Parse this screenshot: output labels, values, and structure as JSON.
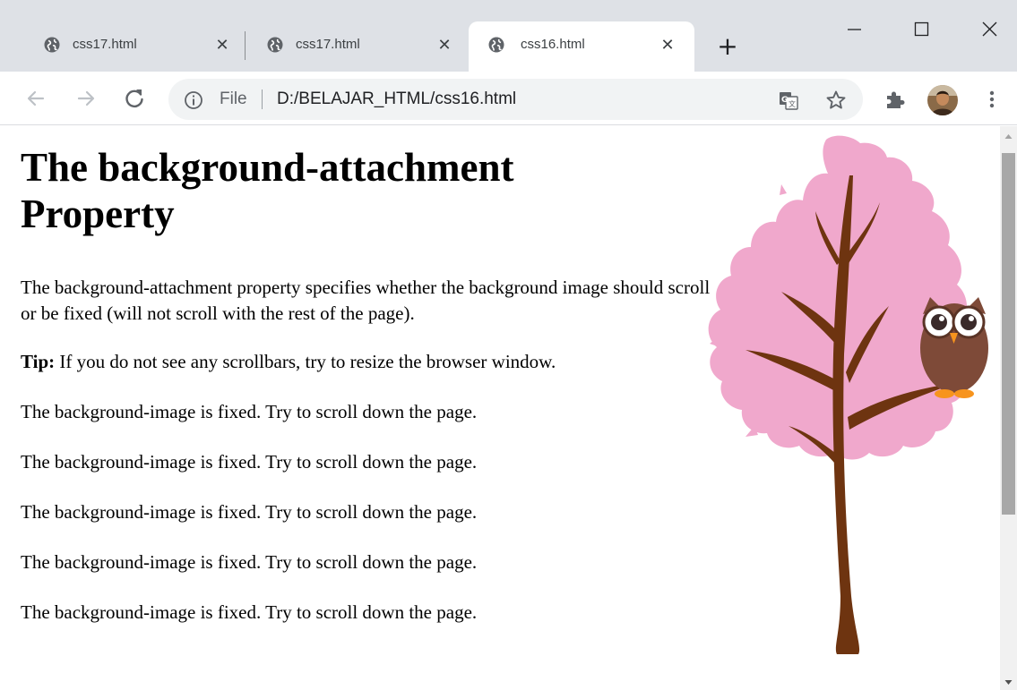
{
  "tabs": [
    {
      "title": "css17.html",
      "close": "✕"
    },
    {
      "title": "css17.html",
      "close": "✕"
    },
    {
      "title": "css16.html",
      "close": "✕",
      "active": true
    }
  ],
  "new_tab": "+",
  "window_controls": [
    "minimize-icon",
    "maximize-icon",
    "close-icon"
  ],
  "omnibox": {
    "scheme": "File",
    "url": "D:/BELAJAR_HTML/css16.html"
  },
  "page": {
    "heading": "The background-attachment Property",
    "intro": "The background-attachment property specifies whether the background image should scroll or be fixed (will not scroll with the rest of the page).",
    "tip_label": "Tip:",
    "tip_text": " If you do not see any scrollbars, try to resize the browser window.",
    "fixed_lines": [
      "The background-image is fixed. Try to scroll down the page.",
      "The background-image is fixed. Try to scroll down the page.",
      "The background-image is fixed. Try to scroll down the page.",
      "The background-image is fixed. Try to scroll down the page.",
      "The background-image is fixed. Try to scroll down the page."
    ]
  },
  "colors": {
    "tabstrip": "#dee1e6",
    "omnibox": "#f1f3f4",
    "tree_foliage": "#f0a8cc",
    "tree_trunk": "#6e3410",
    "owl_body": "#7e4a38",
    "owl_feet": "#f7941d"
  }
}
